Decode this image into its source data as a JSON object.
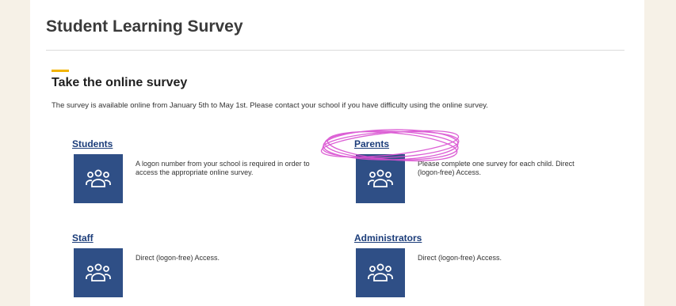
{
  "page": {
    "title": "Student Learning Survey"
  },
  "section": {
    "title": "Take the online survey",
    "intro": "The survey is available online from January 5th to May 1st. Please contact your school if you have difficulty using the online survey."
  },
  "cards": [
    {
      "label": "Students",
      "desc": "A logon number from your school is required in order to access the appropriate online survey.",
      "icon": "people-group-icon"
    },
    {
      "label": "Parents",
      "desc": "Please complete one survey for each child. Direct (logon-free) Access.",
      "icon": "people-group-icon"
    },
    {
      "label": "Staff",
      "desc": "Direct (logon-free) Access.",
      "icon": "people-group-icon"
    },
    {
      "label": "Administrators",
      "desc": "Direct (logon-free) Access.",
      "icon": "people-group-icon"
    }
  ],
  "colors": {
    "background": "#f6f1e7",
    "accent": "#f2b400",
    "link": "#1c3d7a",
    "icon_tile": "#2f4f86",
    "highlight": "#d94fd1"
  }
}
